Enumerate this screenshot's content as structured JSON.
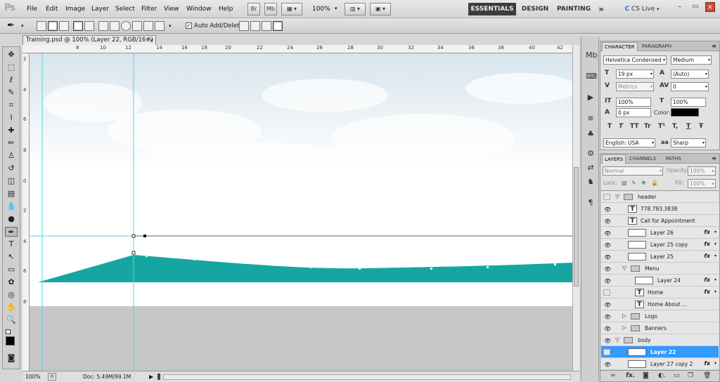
{
  "app": {
    "logo": "Ps",
    "menu": [
      "File",
      "Edit",
      "Image",
      "Layer",
      "Select",
      "Filter",
      "View",
      "Window",
      "Help"
    ],
    "bridge_label": "Br",
    "minibridge_label": "Mb",
    "zoom": "100%",
    "workspaces": [
      "ESSENTIALS",
      "DESIGN",
      "PAINTING"
    ],
    "more_glyph": "»",
    "cslive": "CS Live"
  },
  "options": {
    "auto_add_delete": "Auto Add/Delete"
  },
  "document": {
    "tab_title": "Training.psd @ 100% (Layer 22, RGB/16#) *",
    "close_glyph": "×",
    "ruler_top": [
      "8",
      "10",
      "12",
      "14",
      "16",
      "18",
      "20",
      "22",
      "24",
      "26",
      "28",
      "30",
      "32",
      "34",
      "36",
      "38",
      "40",
      "42"
    ],
    "ruler_left": [
      "2",
      "4",
      "6",
      "8",
      "0",
      "2",
      "4",
      "6",
      "8"
    ],
    "zoom": "100%",
    "doc_size": "Doc: 5.49M/99.1M"
  },
  "character": {
    "tabs": [
      "CHARACTER",
      "PARAGRAPH"
    ],
    "font_family": "Helvetica Condensed",
    "font_style": "Medium",
    "size": "19 px",
    "leading": "(Auto)",
    "kerning": "Metrics",
    "tracking": "0",
    "vscale": "100%",
    "hscale": "100%",
    "baseline": "0 px",
    "color_label": "Color:",
    "color_value": "#000000",
    "language": "English: USA",
    "aa_label": "aa",
    "antialias": "Sharp",
    "type_styles": [
      "T",
      "T",
      "TT",
      "Tr",
      "T¹",
      "T,",
      "T",
      "Ŧ"
    ]
  },
  "layers": {
    "tabs": [
      "LAYERS",
      "CHANNELS",
      "PATHS"
    ],
    "blend_mode": "Normal",
    "opacity_label": "Opacity:",
    "opacity": "100%",
    "lock_label": "Lock:",
    "fill_label": "Fill:",
    "fill": "100%",
    "rows": [
      {
        "name": "header",
        "kind": "group",
        "indent": 0,
        "visible": false,
        "expanded": true
      },
      {
        "name": "778.783.3838",
        "kind": "text",
        "indent": 1,
        "visible": true
      },
      {
        "name": "Call for Appointment",
        "kind": "text",
        "indent": 1,
        "visible": true
      },
      {
        "name": "Layer 26",
        "kind": "pixel",
        "indent": 1,
        "visible": true,
        "fx": true
      },
      {
        "name": "Layer 25 copy",
        "kind": "pixel",
        "indent": 1,
        "visible": true,
        "fx": true
      },
      {
        "name": "Layer 25",
        "kind": "pixel",
        "indent": 1,
        "visible": true,
        "fx": true
      },
      {
        "name": "Menu",
        "kind": "group",
        "indent": 1,
        "visible": true,
        "expanded": true
      },
      {
        "name": "Layer 24",
        "kind": "pixel",
        "indent": 2,
        "visible": true,
        "fx": true
      },
      {
        "name": "Home",
        "kind": "text",
        "indent": 2,
        "visible": false,
        "fx": true
      },
      {
        "name": "Home       About      ...",
        "kind": "text",
        "indent": 2,
        "visible": true
      },
      {
        "name": "Logo",
        "kind": "group",
        "indent": 1,
        "visible": true,
        "expanded": false
      },
      {
        "name": "Banners",
        "kind": "group",
        "indent": 1,
        "visible": true,
        "expanded": false
      },
      {
        "name": "body",
        "kind": "group",
        "indent": 0,
        "visible": true,
        "expanded": true
      },
      {
        "name": "Layer 22",
        "kind": "pixel",
        "indent": 1,
        "visible": false,
        "selected": true
      },
      {
        "name": "Layer 27 copy 2",
        "kind": "pixel",
        "indent": 1,
        "visible": true,
        "fx": true
      }
    ]
  },
  "colors": {
    "teal": "#16a6a2",
    "selection": "#3399ff",
    "guide": "#4fd6e6"
  }
}
